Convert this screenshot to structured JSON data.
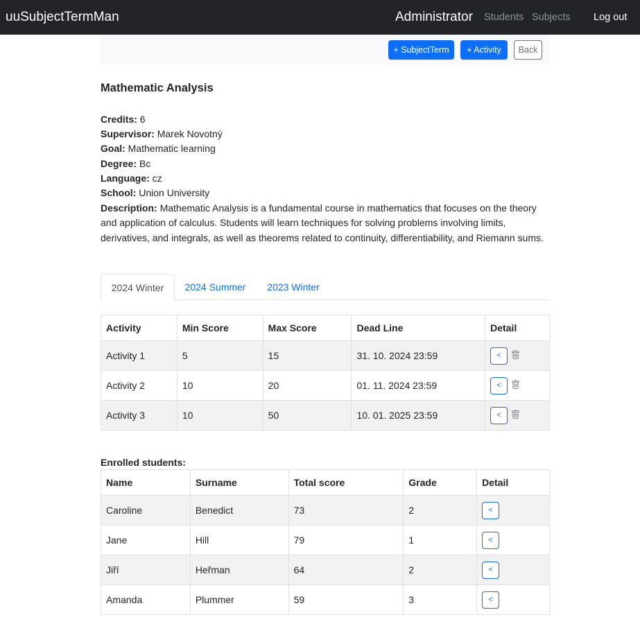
{
  "navbar": {
    "brand": "uuSubjectTermMan",
    "role": "Administrator",
    "students_link": "Students",
    "subjects_link": "Subjects",
    "logout": "Log out"
  },
  "toolbar": {
    "subjectterm_label": "+ SubjectTerm",
    "activity_label": "+ Activity",
    "back_label": "Back"
  },
  "subject": {
    "title": "Mathematic Analysis",
    "fields": [
      {
        "label": "Credits:",
        "value": "6"
      },
      {
        "label": "Supervisor:",
        "value": "Marek Novotný"
      },
      {
        "label": "Goal:",
        "value": "Mathematic learning"
      },
      {
        "label": "Degree:",
        "value": "Bc"
      },
      {
        "label": "Language:",
        "value": "cz"
      },
      {
        "label": "School:",
        "value": "Union University"
      }
    ],
    "description_label": "Description:",
    "description": "Mathematic Analysis is a fundamental course in mathematics that focuses on the theory and application of calculus. Students will learn techniques for solving problems involving limits, derivatives, and integrals, as well as theorems related to continuity, differentiability, and Riemann sums."
  },
  "tabs": [
    {
      "label": "2024 Winter",
      "active": true
    },
    {
      "label": "2024 Summer",
      "active": false
    },
    {
      "label": "2023 Winter",
      "active": false
    }
  ],
  "activities": {
    "headers": [
      "Activity",
      "Min Score",
      "Max Score",
      "Dead Line",
      "Detail"
    ],
    "rows": [
      {
        "name": "Activity 1",
        "min": "5",
        "max": "15",
        "deadline": "31. 10. 2024 23:59"
      },
      {
        "name": "Activity 2",
        "min": "10",
        "max": "20",
        "deadline": "01. 11. 2024 23:59"
      },
      {
        "name": "Activity 3",
        "min": "10",
        "max": "50",
        "deadline": "10. 01. 2025 23:59"
      }
    ]
  },
  "students": {
    "label": "Enrolled students:",
    "headers": [
      "Name",
      "Surname",
      "Total score",
      "Grade",
      "Detail"
    ],
    "rows": [
      {
        "name": "Caroline",
        "surname": "Benedict",
        "score": "73",
        "grade": "2"
      },
      {
        "name": "Jane",
        "surname": "Hill",
        "score": "79",
        "grade": "1"
      },
      {
        "name": "Jiří",
        "surname": "Heřman",
        "score": "64",
        "grade": "2"
      },
      {
        "name": "Amanda",
        "surname": "Plummer",
        "score": "59",
        "grade": "3"
      }
    ]
  },
  "detail_glyph": "<",
  "icons": {
    "detail": "chevron-left-icon",
    "delete": "trash-icon"
  },
  "colors": {
    "primary": "#0d6efd",
    "navbar": "#212529",
    "secondary": "#6c757d"
  }
}
